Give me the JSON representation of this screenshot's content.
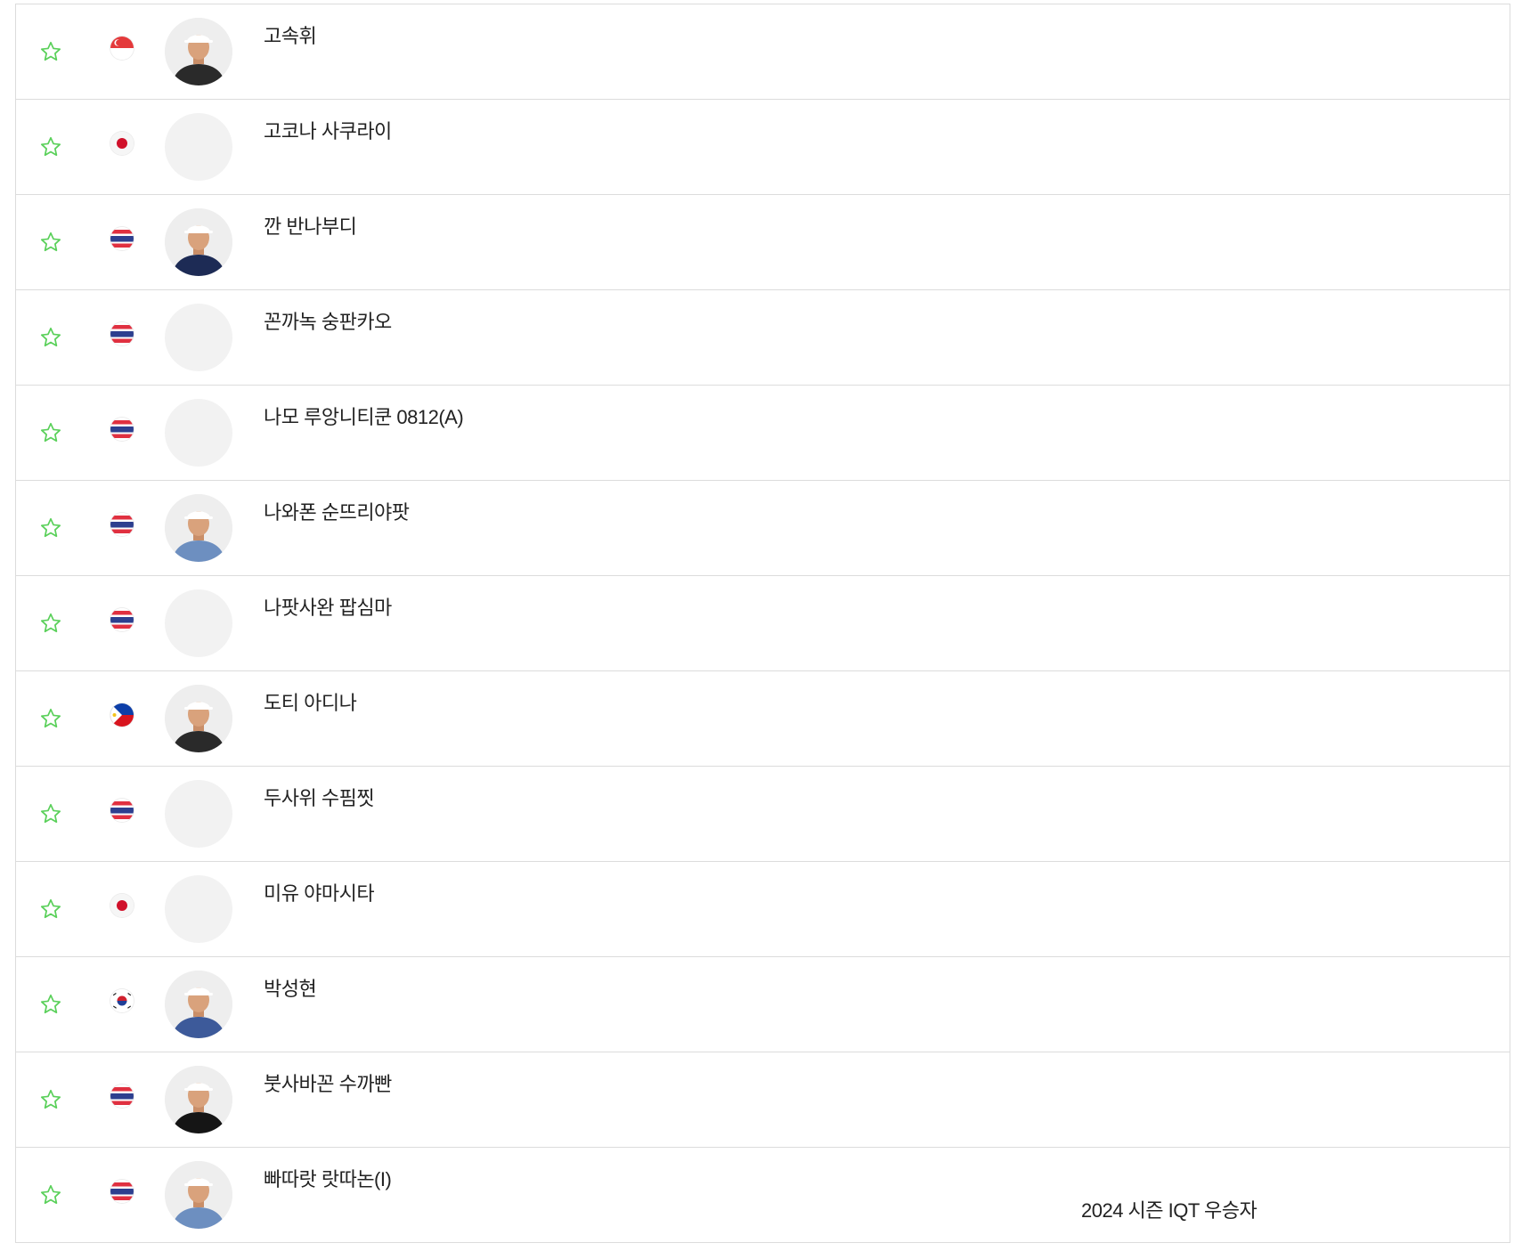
{
  "colors": {
    "star": "#5ad05a",
    "divider": "#dcdcdc",
    "text": "#222222",
    "avatar_placeholder": "#f2f2f2"
  },
  "players": [
    {
      "name": "고속휘",
      "flag": "singapore-flag",
      "photo": "player-photo"
    },
    {
      "name": "고코나 사쿠라이",
      "flag": "japan-flag",
      "photo": "placeholder"
    },
    {
      "name": "깐 반나부디",
      "flag": "thailand-flag",
      "photo": "player-photo"
    },
    {
      "name": "꼰까녹 숭판카오",
      "flag": "thailand-flag",
      "photo": "placeholder"
    },
    {
      "name": "나모 루앙니티쿤 0812(A)",
      "flag": "thailand-flag",
      "photo": "placeholder"
    },
    {
      "name": "나와폰 순뜨리야팟",
      "flag": "thailand-flag",
      "photo": "player-photo"
    },
    {
      "name": "나팟사완 팝심마",
      "flag": "thailand-flag",
      "photo": "placeholder"
    },
    {
      "name": "도티 아디나",
      "flag": "philippines-flag",
      "photo": "player-photo"
    },
    {
      "name": "두사위 수핌찟",
      "flag": "thailand-flag",
      "photo": "placeholder"
    },
    {
      "name": "미유 야마시타",
      "flag": "japan-flag",
      "photo": "placeholder"
    },
    {
      "name": "박성현",
      "flag": "korea-flag",
      "photo": "player-photo"
    },
    {
      "name": "붓사바꼰 수까빤",
      "flag": "thailand-flag",
      "photo": "player-photo"
    },
    {
      "name": "빠따랏 랏따논(I)",
      "flag": "thailand-flag",
      "photo": "player-photo",
      "note": "2024 시즌 IQT 우승자"
    }
  ]
}
